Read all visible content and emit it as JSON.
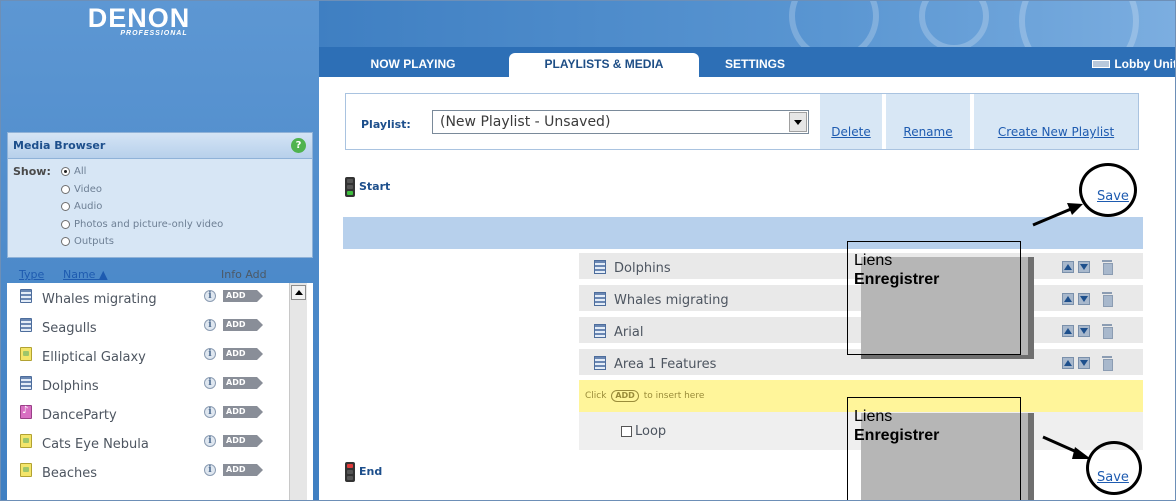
{
  "app": {
    "logo_main": "DENON",
    "logo_sub": "PROFESSIONAL"
  },
  "tabs": [
    {
      "label": "NOW PLAYING"
    },
    {
      "label": "PLAYLISTS & MEDIA",
      "active": true
    },
    {
      "label": "SETTINGS"
    }
  ],
  "unit": {
    "label": "Lobby Unit"
  },
  "media_browser": {
    "title": "Media Browser",
    "help_badge": "?",
    "show_label": "Show:",
    "filters": [
      {
        "label": "All",
        "checked": true
      },
      {
        "label": "Video",
        "checked": false
      },
      {
        "label": "Audio",
        "checked": false
      },
      {
        "label": "Photos and picture-only video",
        "checked": false
      },
      {
        "label": "Outputs",
        "checked": false
      }
    ],
    "columns": {
      "type": "Type",
      "name": "Name ▲",
      "info_add": "Info Add"
    },
    "items": [
      {
        "name": "Whales migrating",
        "kind": "video"
      },
      {
        "name": "Seagulls",
        "kind": "video"
      },
      {
        "name": "Elliptical Galaxy",
        "kind": "photo"
      },
      {
        "name": "Dolphins",
        "kind": "video"
      },
      {
        "name": "DanceParty",
        "kind": "audio"
      },
      {
        "name": "Cats Eye Nebula",
        "kind": "photo"
      },
      {
        "name": "Beaches",
        "kind": "photo"
      }
    ],
    "info_glyph": "i",
    "add_label": "ADD"
  },
  "playlist": {
    "label": "Playlist:",
    "selected": "(New Playlist - Unsaved)",
    "actions": {
      "delete": "Delete",
      "rename": "Rename",
      "create": "Create New Playlist"
    },
    "start_label": "Start",
    "end_label": "End",
    "save_label": "Save",
    "items": [
      {
        "name": "Dolphins"
      },
      {
        "name": "Whales migrating"
      },
      {
        "name": "Arial"
      },
      {
        "name": "Area 1 Features"
      }
    ],
    "insert_hint_pre": "Click",
    "insert_hint_add": "ADD",
    "insert_hint_post": "to insert here",
    "loop_label": "Loop"
  },
  "annotations": {
    "callout_line1": "Liens",
    "callout_line2": "Enregistrer"
  },
  "colors": {
    "brand_blue": "#3f7fc2",
    "link_blue": "#1e5bb0",
    "insert_yellow": "#fff59a"
  }
}
